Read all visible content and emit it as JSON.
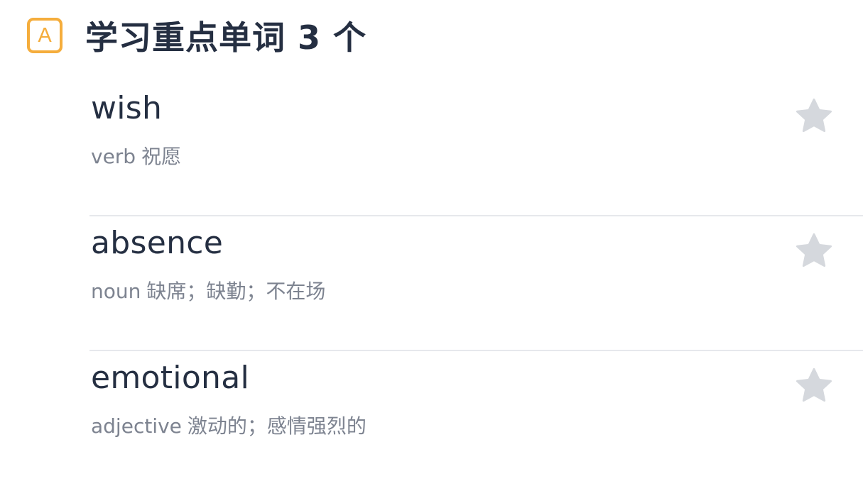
{
  "header": {
    "badge_letter": "A",
    "title": "学习重点单词 3 个"
  },
  "words": [
    {
      "word": "wish",
      "pos": "verb",
      "meaning": "祝愿",
      "starred": false
    },
    {
      "word": "absence",
      "pos": "noun",
      "meaning": "缺席；缺勤；不在场",
      "starred": false
    },
    {
      "word": "emotional",
      "pos": "adjective",
      "meaning": "激动的；感情强烈的",
      "starred": false
    }
  ],
  "colors": {
    "accent": "#f5ad3c",
    "title_text": "#252f42",
    "secondary_text": "#7d8390",
    "star_inactive": "#d5d8dd",
    "divider": "#e6e8ec"
  }
}
